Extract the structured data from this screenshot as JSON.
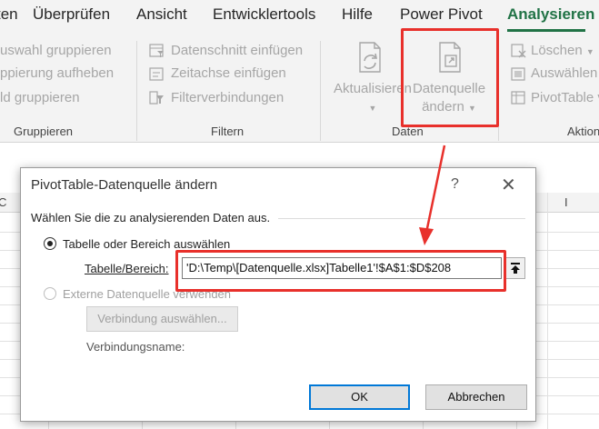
{
  "tabs": [
    "Überprüfen",
    "Ansicht",
    "Entwicklertools",
    "Hilfe",
    "Power Pivot",
    "Analysieren"
  ],
  "tab_partial": "ten",
  "ribbon": {
    "group_gruppieren": {
      "items": [
        "uswahl gruppieren",
        "ppierung aufheben",
        "ld gruppieren"
      ],
      "label": "Gruppieren"
    },
    "group_filtern": {
      "items": [
        "Datenschnitt einfügen",
        "Zeitachse einfügen",
        "Filterverbindungen"
      ],
      "label": "Filtern"
    },
    "group_daten": {
      "refresh_label_1": "Aktualisieren",
      "change_source_label_1": "Datenquelle",
      "change_source_label_2": "ändern",
      "label": "Daten"
    },
    "group_aktionen": {
      "items": [
        "Löschen",
        "Auswählen",
        "PivotTable v"
      ],
      "label": "Aktion"
    }
  },
  "grid": {
    "col_letters": [
      "C",
      "I"
    ]
  },
  "dialog": {
    "title": "PivotTable-Datenquelle ändern",
    "help": "?",
    "close": "✕",
    "prompt": "Wählen Sie die zu analysierenden Daten aus.",
    "option_table": "Tabelle oder Bereich auswählen",
    "range_label": "Tabelle/Bereich:",
    "range_value": "'D:\\Temp\\[Datenquelle.xlsx]Tabelle1'!$A$1:$D$208",
    "option_external": "Externe Datenquelle verwenden",
    "choose_connection": "Verbindung auswählen...",
    "connection_name_label": "Verbindungsname:",
    "ok": "OK",
    "cancel": "Abbrechen"
  },
  "colors": {
    "accent_green": "#217346",
    "highlight_red": "#e8302b",
    "focus_blue": "#0078d7"
  }
}
